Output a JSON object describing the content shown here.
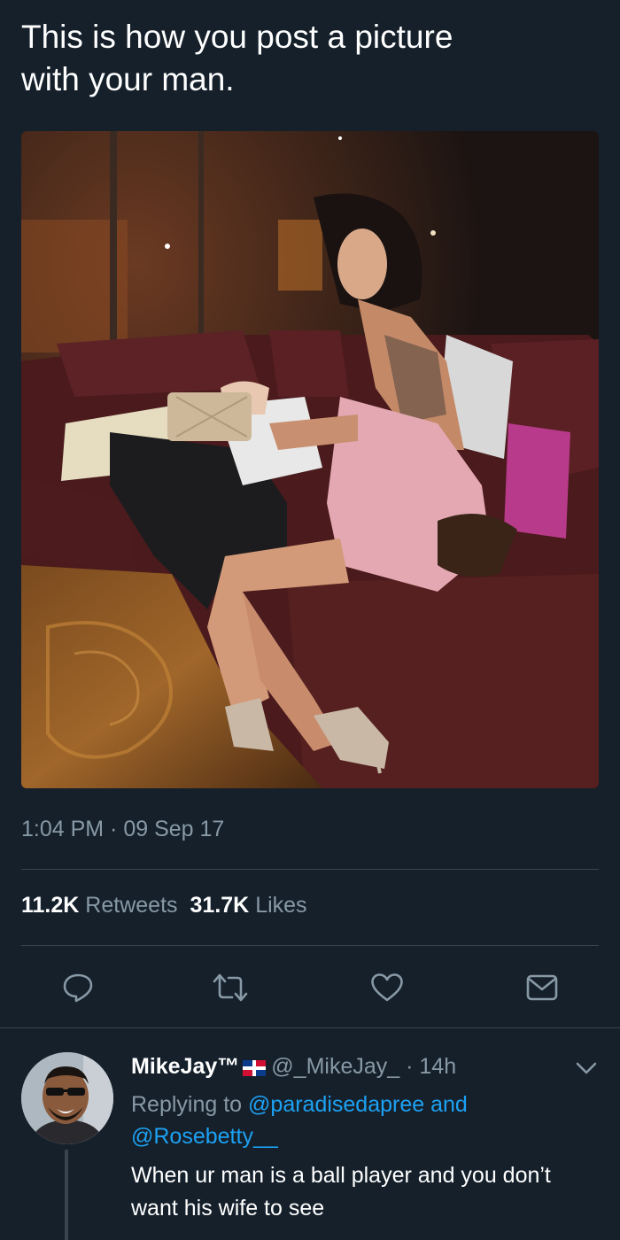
{
  "tweet": {
    "text": "This is how you post a picture\nwith your man.",
    "timestamp": "1:04 PM · 09 Sep 17",
    "retweets_count": "11.2K",
    "retweets_label": "Retweets",
    "likes_count": "31.7K",
    "likes_label": "Likes"
  },
  "actions": [
    {
      "name": "reply",
      "icon": "reply-icon"
    },
    {
      "name": "retweet",
      "icon": "retweet-icon"
    },
    {
      "name": "like",
      "icon": "heart-icon"
    },
    {
      "name": "share",
      "icon": "mail-icon"
    }
  ],
  "reply": {
    "display_name": "MikeJay™",
    "handle": "@_MikeJay_",
    "time": "· 14h",
    "replying_prefix": "Replying to",
    "mention_1": "@paradisedapree",
    "and_word": "and",
    "mention_2": "@Rosebetty__",
    "text": "When ur man is a ball player and you don’t want his wife to see"
  },
  "colors": {
    "background": "#15202b",
    "secondary_text": "#8899a6",
    "link": "#1da1f2",
    "divider": "#38444d"
  }
}
